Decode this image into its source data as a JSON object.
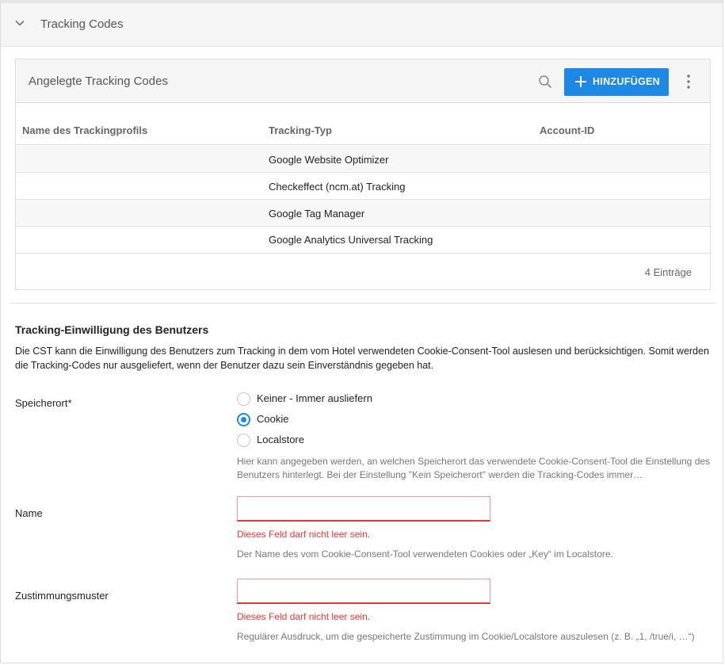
{
  "section": {
    "title": "Tracking Codes"
  },
  "card": {
    "title": "Angelegte Tracking Codes",
    "add_label": "HINZUFÜGEN",
    "columns": [
      "Name des Trackingprofils",
      "Tracking-Typ",
      "Account-ID"
    ],
    "rows": [
      [
        "",
        "Google Website Optimizer",
        ""
      ],
      [
        "",
        "Checkeffect (ncm.at) Tracking",
        ""
      ],
      [
        "",
        "Google Tag Manager",
        ""
      ],
      [
        "",
        "Google Analytics Universal Tracking",
        ""
      ]
    ],
    "count": "4 Einträge"
  },
  "consent": {
    "title": "Tracking-Einwilligung des Benutzers",
    "description": "Die CST kann die Einwilligung des Benutzers zum Tracking in dem vom Hotel verwendeten Cookie-Consent-Tool auslesen und berücksichtigen. Somit werden die Tracking-Codes nur ausgeliefert, wenn der Benutzer dazu sein Einverständnis gegeben hat."
  },
  "storage": {
    "label": "Speicherort*",
    "options": [
      {
        "label": "Keiner - Immer ausliefern",
        "checked": false
      },
      {
        "label": "Cookie",
        "checked": true
      },
      {
        "label": "Localstore",
        "checked": false
      }
    ],
    "hint": "Hier kann angegeben werden, an welchen Speicherort das verwendete Cookie-Consent-Tool die Einstellung des Benutzers hinterlegt. Bei der Einstellung \"Kein Speicherort\" werden die Tracking-Codes immer…"
  },
  "name_field": {
    "label": "Name",
    "value": "",
    "error": "Dieses Feld darf nicht leer sein.",
    "hint": "Der Name des vom Cookie-Consent-Tool verwendeten Cookies oder „Key“ im Localstore."
  },
  "pattern_field": {
    "label": "Zustimmungsmuster",
    "value": "",
    "error": "Dieses Feld darf nicht leer sein.",
    "hint": "Regulärer Ausdruck, um die gespeicherte Zustimmung im Cookie/Localstore auszulesen (z. B. „1, /true/i, …“)"
  },
  "colors": {
    "accent": "#1e88e5",
    "error": "#e53935",
    "header_bg": "#f5f5f5"
  },
  "icons": [
    "chevron-down-icon",
    "search-icon",
    "plus-icon",
    "more-vertical-icon"
  ]
}
